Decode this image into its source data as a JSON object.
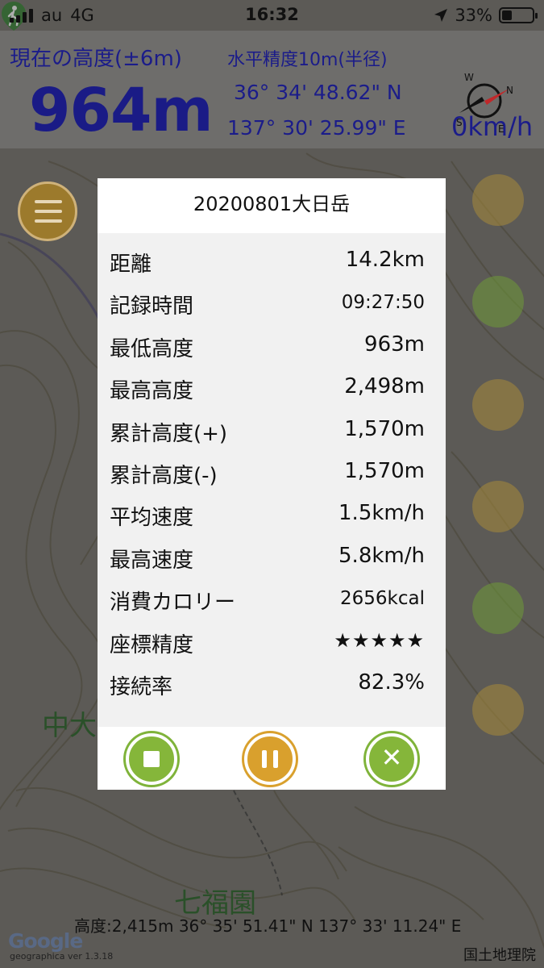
{
  "status_bar": {
    "carrier": "au",
    "network": "4G",
    "time": "16:32",
    "battery": "33%",
    "battery_level": 0.33
  },
  "header": {
    "altitude_label": "現在の高度(±6m)",
    "altitude_value": "964m",
    "accuracy_label": "水平精度10m(半径)",
    "latitude": "36° 34' 48.62\" N",
    "longitude": "137° 30' 25.99\" E",
    "speed": "0km/h"
  },
  "compass": {
    "n": "N",
    "s": "S",
    "e": "E",
    "w": "W"
  },
  "dialog": {
    "title": "20200801大日岳",
    "rows": [
      {
        "label": "距離",
        "value": "14.2km"
      },
      {
        "label": "記録時間",
        "value": "09:27:50"
      },
      {
        "label": "最低高度",
        "value": "963m"
      },
      {
        "label": "最高高度",
        "value": "2,498m"
      },
      {
        "label": "累計高度(+)",
        "value": "1,570m"
      },
      {
        "label": "累計高度(-)",
        "value": "1,570m"
      },
      {
        "label": "平均速度",
        "value": "1.5km/h"
      },
      {
        "label": "最高速度",
        "value": "5.8km/h"
      },
      {
        "label": "消費カロリー",
        "value": "2656kcal"
      },
      {
        "label": "座標精度",
        "value": "★★★★★"
      },
      {
        "label": "接続率",
        "value": "82.3%"
      }
    ]
  },
  "map": {
    "labels": [
      "大日岳",
      "七福園",
      "中大"
    ]
  },
  "footer": {
    "cursor_info": "高度:2,415m  36° 35' 51.41\" N 137° 33' 11.24\" E",
    "google": "Google",
    "version": "geographica ver 1.3.18",
    "gsi_credit": "国土地理院"
  },
  "colors": {
    "header_text": "#1b1c8a",
    "green_button": "#85b63a",
    "orange_button": "#d9a02d"
  }
}
